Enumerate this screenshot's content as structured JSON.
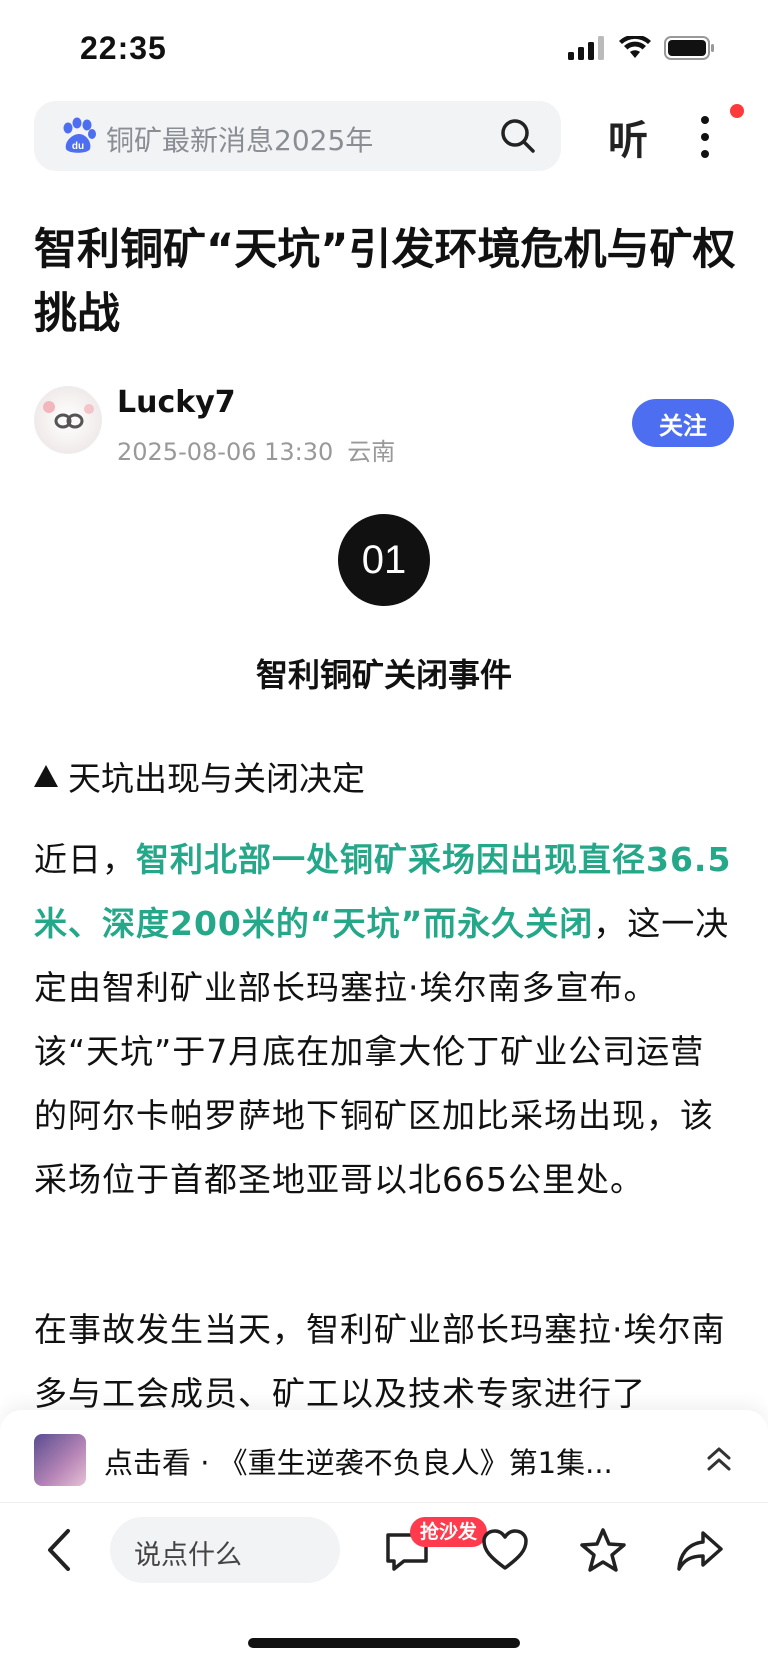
{
  "status_bar": {
    "time": "22:35"
  },
  "search": {
    "text": "铜矿最新消息2025年"
  },
  "header": {
    "listen_label": "听"
  },
  "article": {
    "title": "智利铜矿“天坑”引发环境危机与矿权挑战",
    "author": {
      "name": "Lucky7",
      "date": "2025-08-06 13:30",
      "location": "云南"
    },
    "follow_label": "关注",
    "section_number": "01",
    "section_title": "智利铜矿关闭事件",
    "subheading": "天坑出现与关闭决定",
    "p1_prefix": "近日，",
    "p1_highlight": "智利北部一处铜矿采场因出现直径36.5米、深度200米的“天坑”而永久关闭",
    "p1_rest": "，这一决定由智利矿业部长玛塞拉·埃尔南多宣布。该“天坑”于7月底在加拿大伦丁矿业公司运营的阿尔卡帕罗萨地下铜矿区加比采场出现，该采场位于首都圣地亚哥以北665公里处。",
    "p2": "在事故发生当天，智利矿业部长玛塞拉·埃尔南多与工会成员、矿工以及技术专家进行了"
  },
  "video_banner": {
    "text": "点击看 · 《重生逆袭不负良人》第1集..."
  },
  "bottom_bar": {
    "comment_placeholder": "说点什么",
    "badge": "抢沙发"
  },
  "colors": {
    "accent": "#4e6ef2",
    "highlight": "#24a889",
    "badge": "#ff3b4d"
  }
}
